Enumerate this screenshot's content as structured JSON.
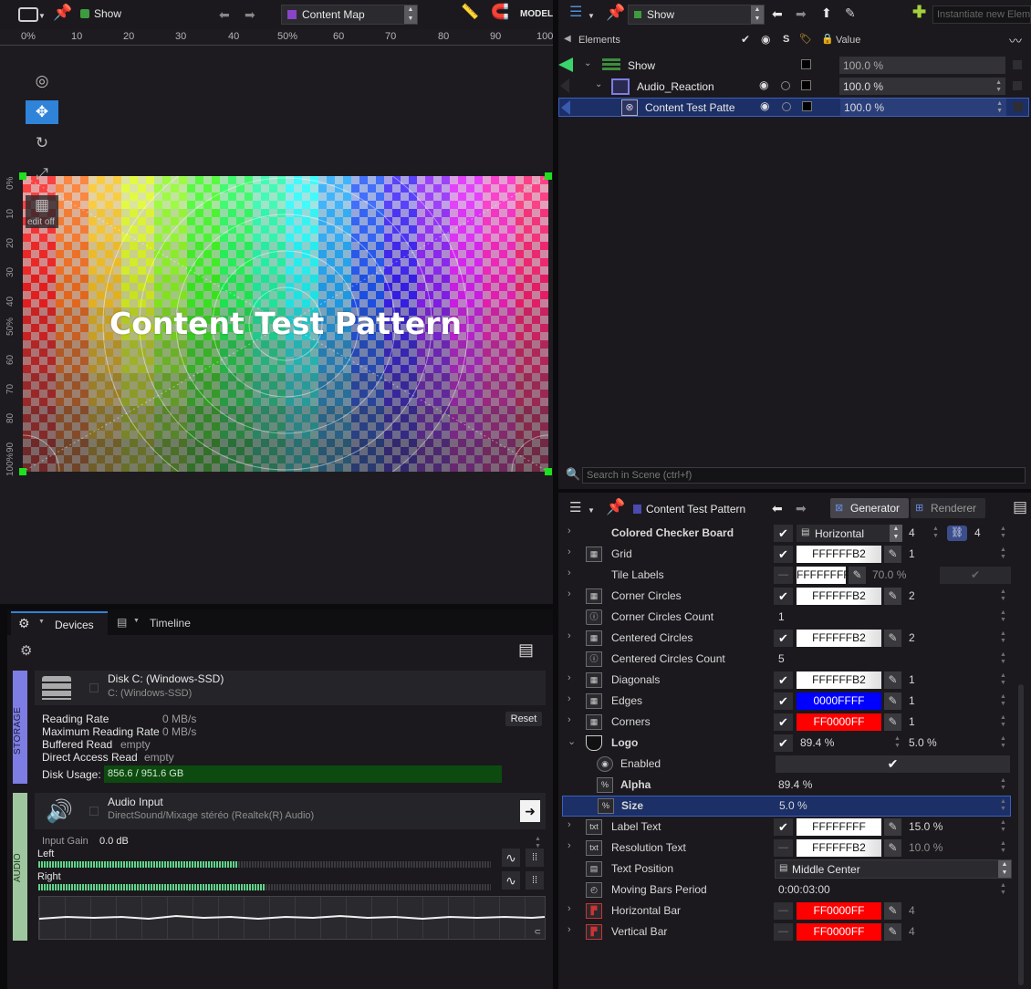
{
  "viewer": {
    "toolbar": {
      "show_label": "Show",
      "content_select": "Content Map",
      "model_label": "MODEL"
    },
    "ruler_h": [
      "0%",
      "10",
      "20",
      "30",
      "40",
      "50%",
      "60",
      "70",
      "80",
      "90",
      "100"
    ],
    "ruler_v": [
      "0%",
      "10",
      "20",
      "30",
      "40",
      "50%",
      "60",
      "70",
      "80",
      "90",
      "100%"
    ],
    "tools": {
      "edit_off_label": "edit off"
    },
    "canvas": {
      "title": "Content Test Pattern"
    }
  },
  "elements": {
    "toolbar": {
      "show_label": "Show",
      "instantiate_placeholder": "Instantiate new Element"
    },
    "header": {
      "elements_label": "Elements",
      "s_label": "S",
      "value_label": "Value"
    },
    "tree": [
      {
        "label": "Show",
        "value": "100.0 %"
      },
      {
        "label": "Audio_Reaction",
        "value": "100.0 %"
      },
      {
        "label": "Content Test Patte",
        "value": "100.0 %"
      }
    ],
    "search_placeholder": "Search in Scene (ctrl+f)"
  },
  "inspector": {
    "title": "Content Test Pattern",
    "tab_generator": "Generator",
    "tab_renderer": "Renderer",
    "rows": [
      {
        "label": "Colored Checker Board",
        "bold": true,
        "select": "Horizontal",
        "v1": "4",
        "v2": "4"
      },
      {
        "label": "Grid",
        "swatch": "FFFFFFB2",
        "v1": "1"
      },
      {
        "label": "Tile Labels",
        "swatch": "FFFFFFFF",
        "v1": "70.0 %"
      },
      {
        "label": "Corner Circles",
        "swatch": "FFFFFFB2",
        "v1": "2"
      },
      {
        "label": "Corner Circles Count",
        "value": "1"
      },
      {
        "label": "Centered Circles",
        "swatch": "FFFFFFB2",
        "v1": "2"
      },
      {
        "label": "Centered Circles Count",
        "value": "5"
      },
      {
        "label": "Diagonals",
        "swatch": "FFFFFFB2",
        "v1": "1"
      },
      {
        "label": "Edges",
        "swatch": "0000FFFF",
        "v1": "1"
      },
      {
        "label": "Corners",
        "swatch": "FF0000FF",
        "v1": "1"
      },
      {
        "label": "Logo",
        "bold": true,
        "v1": "89.4 %",
        "v2": "5.0 %"
      },
      {
        "label": "Enabled"
      },
      {
        "label": "Alpha",
        "bold": true,
        "value": "89.4 %"
      },
      {
        "label": "Size",
        "bold": true,
        "value": "5.0 %"
      },
      {
        "label": "Label Text",
        "swatch": "FFFFFFFF",
        "v1": "15.0 %"
      },
      {
        "label": "Resolution Text",
        "swatch": "FFFFFFB2",
        "v1": "10.0 %"
      },
      {
        "label": "Text Position",
        "select": "Middle Center"
      },
      {
        "label": "Moving Bars Period",
        "value": "0:00:03:00"
      },
      {
        "label": "Horizontal Bar",
        "swatch": "FF0000FF",
        "v1": "4"
      },
      {
        "label": "Vertical Bar",
        "swatch": "FF0000FF",
        "v1": "4"
      }
    ],
    "icon_text": {
      "pct": "%",
      "txt": "txt"
    }
  },
  "devices": {
    "tab_devices": "Devices",
    "tab_timeline": "Timeline",
    "storage": {
      "side_label": "STORAGE",
      "disk_name": "Disk C: (Windows-SSD)",
      "disk_sub": "C: (Windows-SSD)",
      "reading_rate_label": "Reading Rate",
      "reading_rate": "0 MB/s",
      "max_reading_label": "Maximum Reading Rate",
      "max_reading": "0 MB/s",
      "buffered_label": "Buffered Read",
      "buffered": "empty",
      "direct_label": "Direct Access Read",
      "direct": "empty",
      "reset_label": "Reset",
      "disk_usage_label": "Disk Usage:",
      "disk_usage": "856.6 / 951.6 GB",
      "disk_usage_fraction": 0.9
    },
    "audio": {
      "side_label": "AUDIO",
      "input_name": "Audio Input",
      "input_sub": "DirectSound/Mixage stéréo (Realtek(R) Audio)",
      "gain_label": "Input Gain",
      "gain": "0.0 dB",
      "left_label": "Left",
      "right_label": "Right",
      "left_level": 0.44,
      "right_level": 0.5
    }
  },
  "colors": {
    "accent_blue": "#2f83d8",
    "selected_row": "#1c2f66",
    "storage_bar": "#7d7de4",
    "audio_bar": "#9fc79f",
    "disk_fill": "#0d4a10",
    "swatch_white": "#ffffff",
    "swatch_blue": "#0000ff",
    "swatch_red": "#ff0000"
  }
}
